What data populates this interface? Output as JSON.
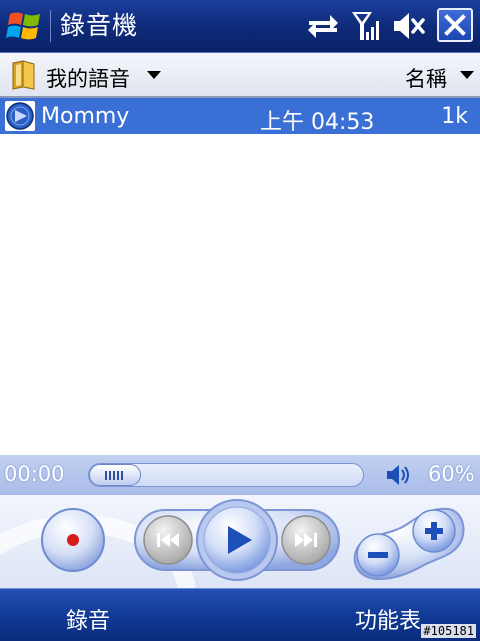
{
  "titlebar": {
    "app_title": "錄音機",
    "icons": [
      "windows-start-icon",
      "data-sync-icon",
      "signal-strength-icon",
      "speaker-muted-icon",
      "close-icon"
    ]
  },
  "header": {
    "folder_label": "我的語音",
    "sort_label": "名稱"
  },
  "files": [
    {
      "name": "Mommy",
      "time": "上午 04:53",
      "size": "1k"
    }
  ],
  "player": {
    "elapsed": "00:00",
    "progress": 0,
    "volume_label": "60%",
    "volume": 0.6
  },
  "softkeys": {
    "left": "錄音",
    "right": "功能表"
  },
  "watermark": "#105181",
  "colors": {
    "accent": "#3a6fd6",
    "bar_dark": "#0e2a78",
    "record_red": "#d81b1b"
  }
}
